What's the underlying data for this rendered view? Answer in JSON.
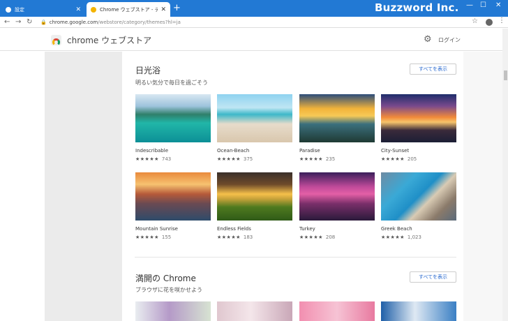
{
  "tabs": [
    {
      "label": "設定",
      "active": false,
      "favicon_color": "#1a73e8"
    },
    {
      "label": "Chrome ウェブストア - テーマ",
      "active": true,
      "favicon_color": "#f4b400"
    }
  ],
  "brand": "Buzzword Inc.",
  "url": {
    "host": "chrome.google.com",
    "path": "/webstore/category/themes?hl=ja"
  },
  "store": {
    "title": "chrome ウェブストア",
    "login": "ログイン"
  },
  "sections": [
    {
      "title": "日光浴",
      "subtitle": "明るい気分で毎日を過ごそう",
      "view_all": "すべてを表示",
      "items": [
        {
          "name": "Indescribable",
          "stars": "★★★★★",
          "count": "743"
        },
        {
          "name": "Ocean-Beach",
          "stars": "★★★★★",
          "count": "375"
        },
        {
          "name": "Paradise",
          "stars": "★★★★★",
          "count": "235"
        },
        {
          "name": "City-Sunset",
          "stars": "★★★★★",
          "count": "205"
        },
        {
          "name": "Mountain Sunrise",
          "stars": "★★★★★",
          "count": "155"
        },
        {
          "name": "Endless Fields",
          "stars": "★★★★★",
          "count": "183"
        },
        {
          "name": "Turkey",
          "stars": "★★★★★",
          "count": "208"
        },
        {
          "name": "Greek Beach",
          "stars": "★★★★★",
          "count": "1,023"
        }
      ]
    },
    {
      "title": "満開の Chrome",
      "subtitle": "ブラウザに花を咲かせよう",
      "view_all": "すべてを表示"
    }
  ],
  "colors": {
    "titlebar": "#2279d4",
    "link": "#2a6acf"
  }
}
